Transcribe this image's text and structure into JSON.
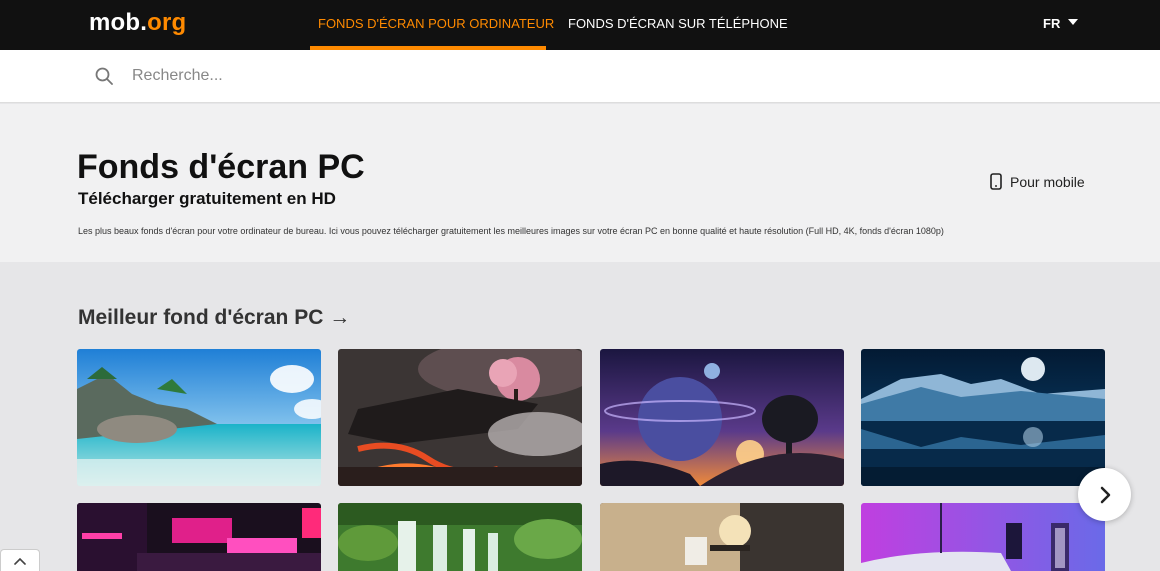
{
  "header": {
    "logo_main": "mob.",
    "logo_accent": "org",
    "nav": [
      {
        "label": "FONDS D'ÉCRAN POUR ORDINATEUR",
        "active": true
      },
      {
        "label": "FONDS D'ÉCRAN SUR TÉLÉPHONE",
        "active": false
      }
    ],
    "language": "FR"
  },
  "search": {
    "placeholder": "Recherche...",
    "value": ""
  },
  "hero": {
    "title": "Fonds d'écran PC",
    "subtitle": "Télécharger gratuitement en HD",
    "description": "Les plus beaux fonds d'écran pour votre ordinateur de bureau. Ici vous pouvez télécharger gratuitement les meilleures images sur votre écran PC en bonne qualité et haute résolution (Full HD, 4K, fonds d'écran 1080p)",
    "mobile_link": "Pour mobile"
  },
  "section": {
    "title": "Meilleur fond d'écran PC",
    "arrow": "→"
  },
  "wallpapers": [
    {
      "subject": "tropical beach with rocks"
    },
    {
      "subject": "cherry blossom tree on floating rock with lava"
    },
    {
      "subject": "planets over sunset hill"
    },
    {
      "subject": "moon over snowy mountain lake"
    },
    {
      "subject": "neon city street"
    },
    {
      "subject": "forest waterfall"
    },
    {
      "subject": "lightbulb figure on wall"
    },
    {
      "subject": "neon car and motel sign"
    }
  ],
  "colors": {
    "accent": "#ff8a00",
    "topbar": "#111111",
    "hero_bg": "#f1f1f2",
    "page_bg": "#e6e6e8"
  }
}
